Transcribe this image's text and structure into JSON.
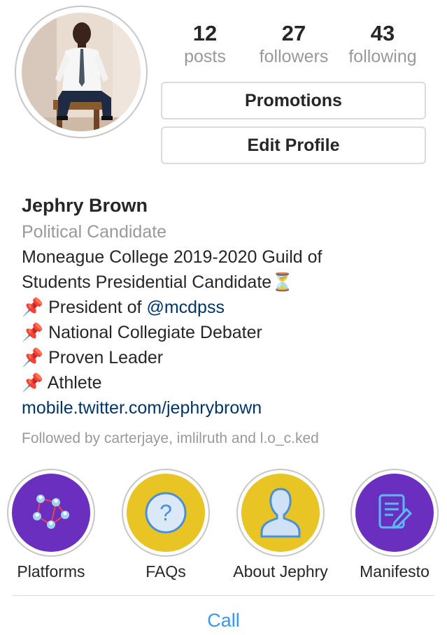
{
  "profile": {
    "stats": [
      {
        "count": "12",
        "label": "posts"
      },
      {
        "count": "27",
        "label": "followers"
      },
      {
        "count": "43",
        "label": "following"
      }
    ],
    "buttons": {
      "promotions": "Promotions",
      "edit_profile": "Edit Profile"
    },
    "name": "Jephry Brown",
    "category": "Political Candidate",
    "bio": {
      "line1": "Moneague College 2019-2020 Guild of",
      "line2": "Students Presidential Candidate",
      "line2_emoji": "⏳",
      "pin": "📌",
      "line3_prefix": "President of ",
      "line3_mention": "@mcdpss",
      "line4": "National Collegiate Debater",
      "line5": "Proven Leader",
      "line6": "Athlete"
    },
    "website": "mobile.twitter.com/jephrybrown",
    "followed_by": "Followed by carterjaye, imlilruth and l.o_c.ked"
  },
  "highlights": [
    {
      "label": "Platforms",
      "icon": "network-icon",
      "color": "#6b2fbf"
    },
    {
      "label": "FAQs",
      "icon": "question-icon",
      "color": "#e8c425"
    },
    {
      "label": "About Jephry",
      "icon": "person-icon",
      "color": "#e8c425"
    },
    {
      "label": "Manifesto",
      "icon": "document-edit-icon",
      "color": "#6b2fbf"
    }
  ],
  "call_label": "Call"
}
